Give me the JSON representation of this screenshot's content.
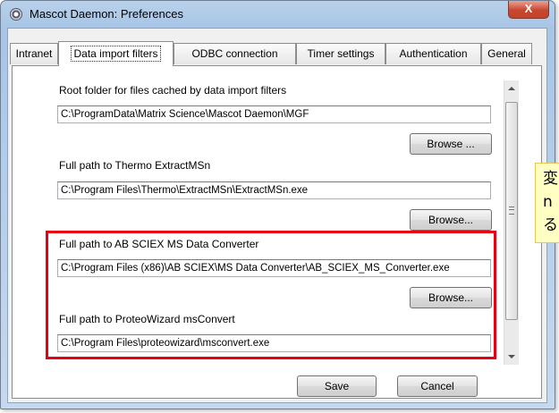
{
  "window": {
    "title": "Mascot Daemon: Preferences",
    "close_glyph": "X"
  },
  "tabs": [
    {
      "label": "Intranet"
    },
    {
      "label": "Data import filters"
    },
    {
      "label": "ODBC connection"
    },
    {
      "label": "Timer settings"
    },
    {
      "label": "Authentication"
    },
    {
      "label": "General"
    }
  ],
  "fields": {
    "root_folder": {
      "label": "Root folder for files cached by data import filters",
      "value": "C:\\ProgramData\\Matrix Science\\Mascot Daemon\\MGF"
    },
    "thermo": {
      "label": "Full path to Thermo ExtractMSn",
      "value": "C:\\Program Files\\Thermo\\ExtractMSn\\ExtractMSn.exe"
    },
    "absciex": {
      "label": "Full path to AB SCIEX MS Data Converter",
      "value": "C:\\Program Files (x86)\\AB SCIEX\\MS Data Converter\\AB_SCIEX_MS_Converter.exe"
    },
    "proteowizard": {
      "label": "Full path to ProteoWizard msConvert",
      "value": "C:\\Program Files\\proteowizard\\msconvert.exe"
    }
  },
  "buttons": {
    "browse_root": "Browse ...",
    "browse_thermo": "Browse...",
    "browse_absciex": "Browse...",
    "save": "Save",
    "cancel": "Cancel"
  },
  "note": {
    "lines": [
      "変",
      "n",
      "る"
    ]
  },
  "colors": {
    "highlight": "#e60012",
    "note_bg": "#ffffc4"
  }
}
